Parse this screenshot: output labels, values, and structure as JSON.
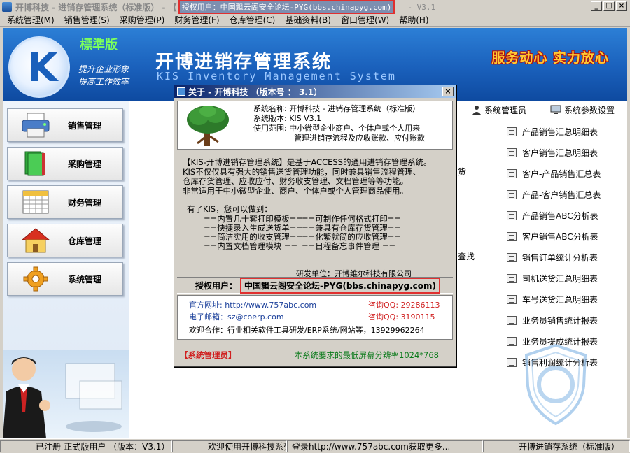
{
  "window": {
    "title": "开博科技 - 进销存管理系统（标准版） - 【",
    "title_auth": "授权用户：中国飘云阁安全论坛-PYG(bbs.chinapyg.com)",
    "version": "- V3.1",
    "buttons": {
      "minimize": "_",
      "maximize": "□",
      "close": "×"
    }
  },
  "menu": [
    "系统管理(M)",
    "销售管理(S)",
    "采购管理(P)",
    "财务管理(F)",
    "仓库管理(C)",
    "基础资料(B)",
    "窗口管理(W)",
    "帮助(H)"
  ],
  "banner": {
    "logo_letter": "K",
    "edition": "標準版",
    "slogan1": "提升企业形象",
    "slogan2": "提高工作效率",
    "title": "开博进销存管理系统",
    "subtitle": "KIS Inventory Management System",
    "motto": "服务动心  实力放心"
  },
  "toolbar_right": {
    "user_label": "系统管理员",
    "settings_label": "系统参数设置"
  },
  "nav": [
    {
      "label": "销售管理",
      "icon": "printer-icon"
    },
    {
      "label": "采购管理",
      "icon": "books-icon"
    },
    {
      "label": "财务管理",
      "icon": "spreadsheet-icon"
    },
    {
      "label": "仓库管理",
      "icon": "house-icon"
    },
    {
      "label": "系统管理",
      "icon": "gear-icon"
    }
  ],
  "reports": [
    "产品销售汇总明细表",
    "客户销售汇总明细表",
    "客户-产品销售汇总表",
    "产品-客户销售汇总表",
    "产品销售ABC分析表",
    "客户销售ABC分析表",
    "销售订单统计分析表",
    "司机送货汇总明细表",
    "车号送货汇总明细表",
    "业务员销售统计报表",
    "业务员提成统计报表",
    "销售利润统计分析表"
  ],
  "side_fragments": {
    "f1": "货",
    "f2": "查找"
  },
  "dialog": {
    "title": "关于 - 开博科技  （版本号 ： 3.1）",
    "info": {
      "name": "系统名称: 开博科技 - 进销存管理系统（标准版）",
      "version": "系统版本: KIS V3.1",
      "scope1": "使用范围: 中小微型企业商户、个体户或个人用来",
      "scope2": "管理进销存流程及应收账款、应付账款"
    },
    "desc": [
      "【KIS-开博进销存管理系统】是基于ACCESS的通用进销存管理系统。",
      " KIS不仅仅具有强大的销售送货管理功能，同时兼具销售流程管理、",
      "仓库存货管理、应收应付、财务收支管理、文档管理等等功能。",
      "非常适用于中小微型企业、商户、个体户或个人管理商品使用。"
    ],
    "features_intro": "有了KIS，您可以做到：",
    "features": [
      [
        "==内置几十套打印模板==",
        "==可制作任何格式打印=="
      ],
      [
        "==快捷录入生成送货单==",
        "==兼具有仓库存货管理=="
      ],
      [
        "==简洁实用的收支管理==",
        "==化繁就简的应收管理=="
      ],
      [
        "==内置文档管理模块  ==",
        "==日程备忘事件管理  =="
      ]
    ],
    "developer": "研发单位：开博维尔科技有限公司",
    "auth_label": "授权用户：",
    "auth_value": "中国飘云阁安全论坛-PYG(bbs.chinapyg.com)",
    "contact": {
      "site_label": "官方网址:",
      "site_value": "http://www.757abc.com",
      "qq1_label": "咨询QQ:",
      "qq1_value": "29286113",
      "email_label": "电子邮箱：",
      "email_value": "sz@coerp.com",
      "qq2_label": "咨询QQ:",
      "qq2_value": "3190115",
      "welcome": "欢迎合作：行业相关软件工具研发/ERP系统/网站等，13929962264"
    },
    "footer_user": "【系统管理员】",
    "footer_req": "本系统要求的最低屏幕分辨率1024*768"
  },
  "status": {
    "registered": "已注册-正式版用户 （版本：V3.1）",
    "welcome": "欢迎使用开博科技系列软件",
    "login": "登录http://www.757abc.com获取更多...",
    "app": "开博进销存系统（标准版）"
  },
  "colors": {
    "banner": "#1a60bb",
    "dialog_title": "#0a246a",
    "highlight_border": "#e03030",
    "edition": "#7cff5c",
    "motto": "#ffcc33"
  }
}
